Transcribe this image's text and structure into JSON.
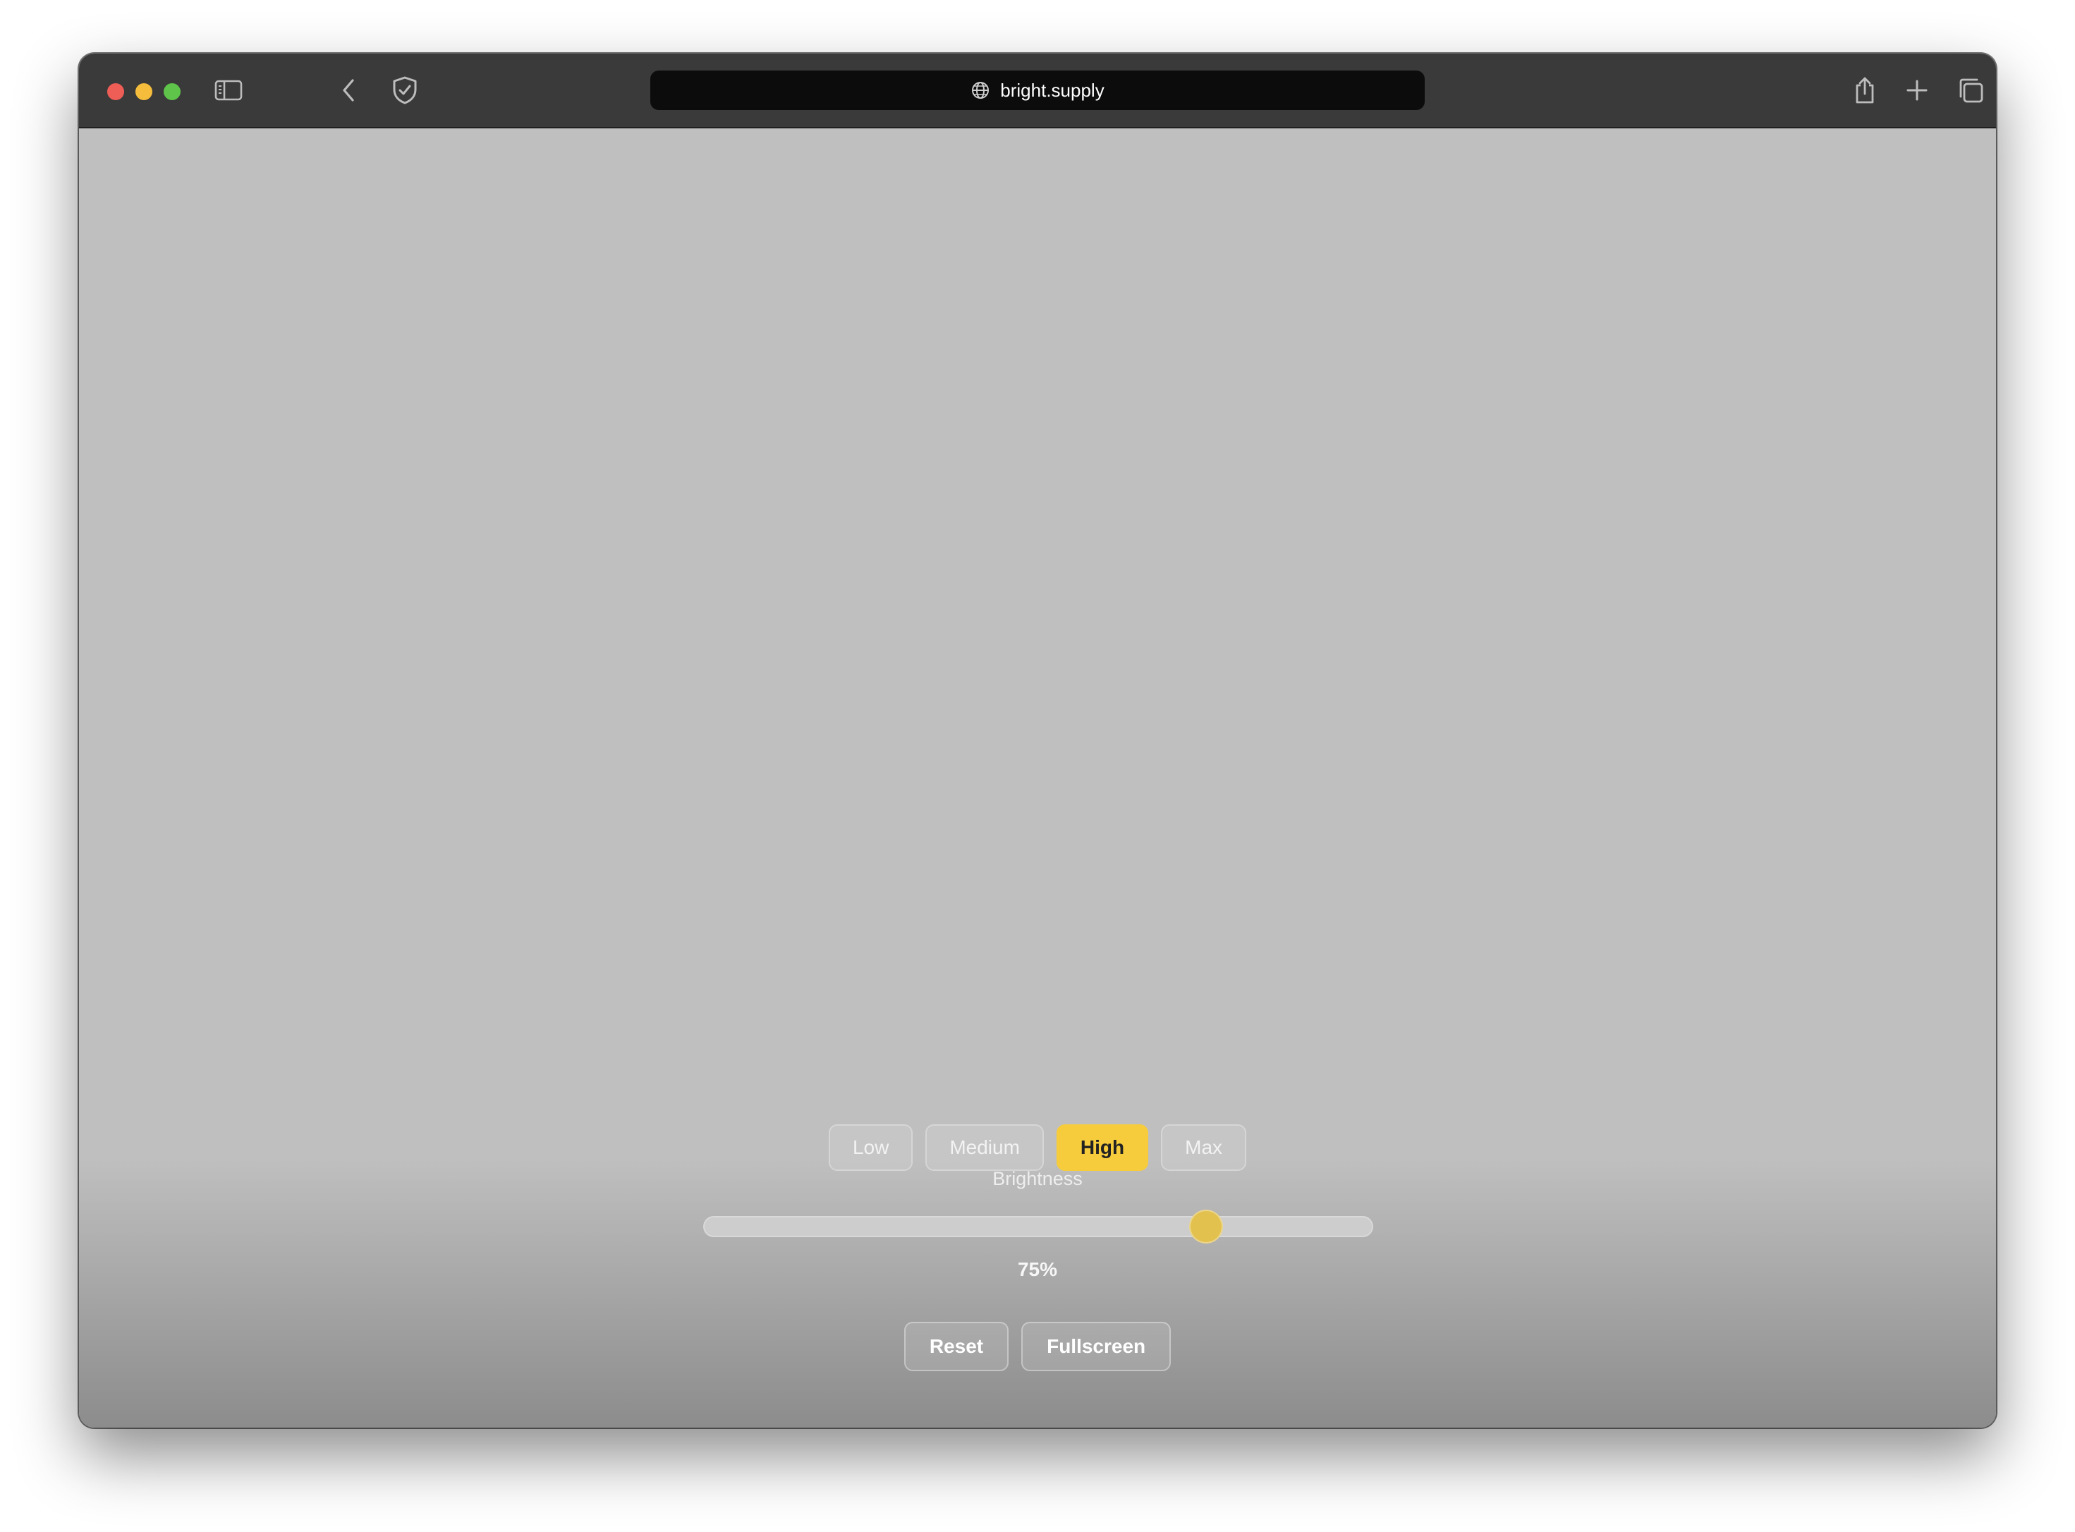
{
  "browser": {
    "url": "bright.supply",
    "icons": {
      "sidebar": "sidebar-icon",
      "back": "chevron-left-icon",
      "privacy": "shield-check-icon",
      "globe": "globe-icon",
      "share": "share-icon",
      "new_tab": "plus-icon",
      "tabs": "tab-overview-icon"
    }
  },
  "controls": {
    "presets": [
      {
        "label": "Low",
        "active": false
      },
      {
        "label": "Medium",
        "active": false
      },
      {
        "label": "High",
        "active": true
      },
      {
        "label": "Max",
        "active": false
      }
    ],
    "brightness_label": "Brightness",
    "brightness_value": 75,
    "brightness_text": "75%",
    "reset_label": "Reset",
    "fullscreen_label": "Fullscreen"
  },
  "colors": {
    "screen": "#bfbfbf",
    "accent": "#f6cc3d",
    "thumb": "#e2c14f"
  }
}
